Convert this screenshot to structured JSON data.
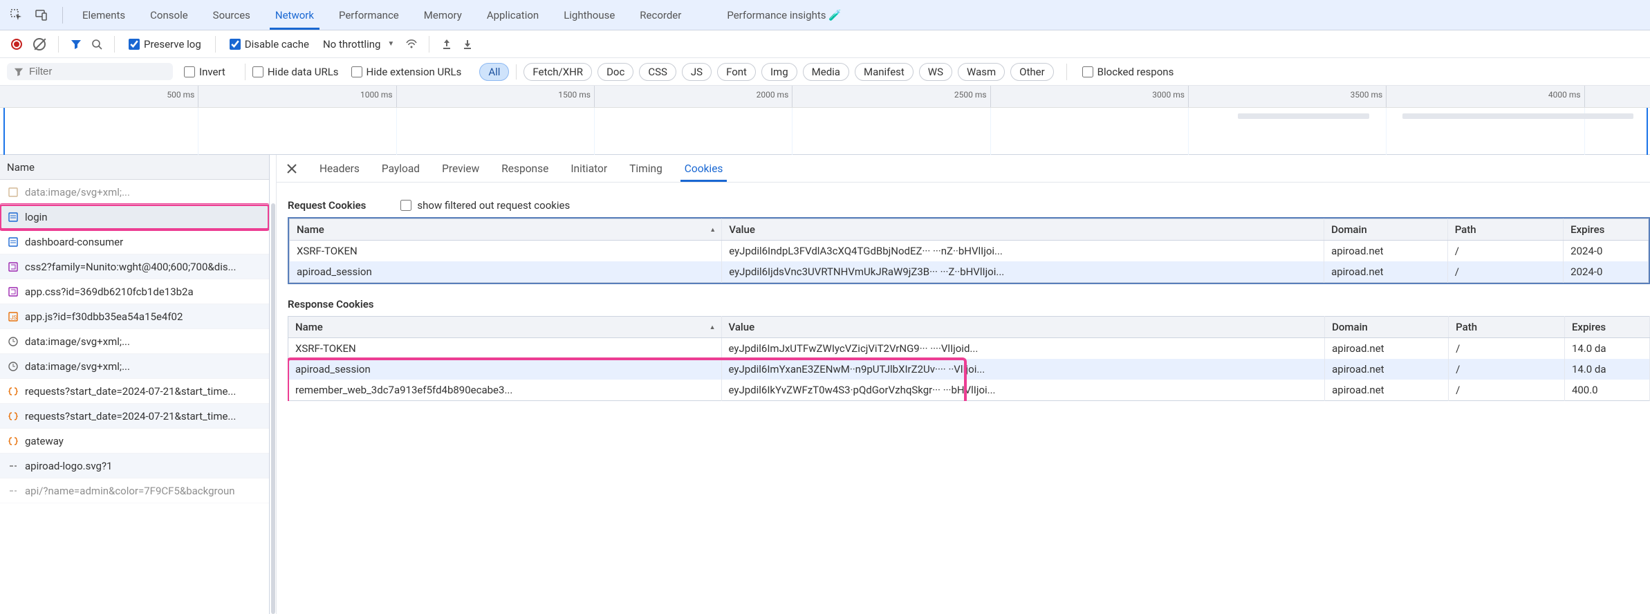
{
  "topTabs": [
    "Elements",
    "Console",
    "Sources",
    "Network",
    "Performance",
    "Memory",
    "Application",
    "Lighthouse",
    "Recorder",
    "Performance insights 🧪"
  ],
  "activeTopTab": "Network",
  "toolbar2": {
    "preserve_log": "Preserve log",
    "disable_cache": "Disable cache",
    "throttling": "No throttling"
  },
  "toolbar3": {
    "filter_placeholder": "Filter",
    "invert": "Invert",
    "hide_data_urls": "Hide data URLs",
    "hide_ext_urls": "Hide extension URLs",
    "type_chips": [
      "All",
      "Fetch/XHR",
      "Doc",
      "CSS",
      "JS",
      "Font",
      "Img",
      "Media",
      "Manifest",
      "WS",
      "Wasm",
      "Other"
    ],
    "active_chip": "All",
    "blocked_response": "Blocked respons"
  },
  "timeline": {
    "ticks": [
      "500 ms",
      "1000 ms",
      "1500 ms",
      "2000 ms",
      "2500 ms",
      "3000 ms",
      "3500 ms",
      "4000 ms"
    ]
  },
  "requests": {
    "header": "Name",
    "items": [
      {
        "label": "data:image/svg+xml;...",
        "icon": "tag",
        "color": "#b08040",
        "faded": true
      },
      {
        "label": "login",
        "icon": "doc",
        "color": "#1967d2",
        "selected": true,
        "highlight": true
      },
      {
        "label": "dashboard-consumer",
        "icon": "doc",
        "color": "#1967d2"
      },
      {
        "label": "css2?family=Nunito:wght@400;600;700&dis...",
        "icon": "css",
        "color": "#9c27b0"
      },
      {
        "label": "app.css?id=369db6210fcb1de13b2a",
        "icon": "css",
        "color": "#9c27b0"
      },
      {
        "label": "app.js?id=f30dbb35ea54a15e4f02",
        "icon": "js",
        "color": "#e8710a"
      },
      {
        "label": "data:image/svg+xml;...",
        "icon": "clock",
        "color": "#666"
      },
      {
        "label": "data:image/svg+xml;...",
        "icon": "clock",
        "color": "#666"
      },
      {
        "label": "requests?start_date=2024-07-21&start_time...",
        "icon": "braces",
        "color": "#e8710a"
      },
      {
        "label": "requests?start_date=2024-07-21&start_time...",
        "icon": "braces",
        "color": "#e8710a"
      },
      {
        "label": "gateway",
        "icon": "braces",
        "color": "#e8710a"
      },
      {
        "label": "apiroad-logo.svg?1",
        "icon": "dash",
        "color": "#888"
      },
      {
        "label": "api/?name=admin&color=7F9CF5&backgroun",
        "icon": "dash",
        "color": "#888",
        "faded": true
      }
    ]
  },
  "detailTabs": [
    "Headers",
    "Payload",
    "Preview",
    "Response",
    "Initiator",
    "Timing",
    "Cookies"
  ],
  "activeDetailTab": "Cookies",
  "requestCookies": {
    "heading": "Request Cookies",
    "show_filtered_label": "show filtered out request cookies",
    "columns": [
      "Name",
      "Value",
      "Domain",
      "Path",
      "Expires"
    ],
    "rows": [
      {
        "name": "XSRF-TOKEN",
        "value": "eyJpdil6IndpL3FVdlA3cXQ4TGdBbjNodEZ···   ···nZ··bHVlIjoi...",
        "domain": "apiroad.net",
        "path": "/",
        "expires": "2024-0"
      },
      {
        "name": "apiroad_session",
        "value": "eyJpdil6IjdsVnc3UVRTNHVmUkJRaW9jZ3B···   ···Z··bHVlIjoi...",
        "domain": "apiroad.net",
        "path": "/",
        "expires": "2024-0"
      }
    ]
  },
  "responseCookies": {
    "heading": "Response Cookies",
    "columns": [
      "Name",
      "Value",
      "Domain",
      "Path",
      "Expires"
    ],
    "rows": [
      {
        "name": "XSRF-TOKEN",
        "value": "eyJpdil6ImJxUTFwZWIycVZicjViT2VrNG9···      ····VlIjoid...",
        "domain": "apiroad.net",
        "path": "/",
        "expires": "14.0 da"
      },
      {
        "name": "apiroad_session",
        "value": "eyJpdil6ImYxanE3ZENwM··n9pUTJlbXIrZ2Uv····          ··VlIjoi...",
        "domain": "apiroad.net",
        "path": "/",
        "expires": "14.0 da"
      },
      {
        "name": "remember_web_3dc7a913ef5fd4b890ecabe3...",
        "value": "eyJpdil6IkYvZWFzT0w4S3·pQdGorVzhqSkgr···   ···bHVlIjoi...",
        "domain": "apiroad.net",
        "path": "/",
        "expires": "400.0"
      }
    ]
  }
}
